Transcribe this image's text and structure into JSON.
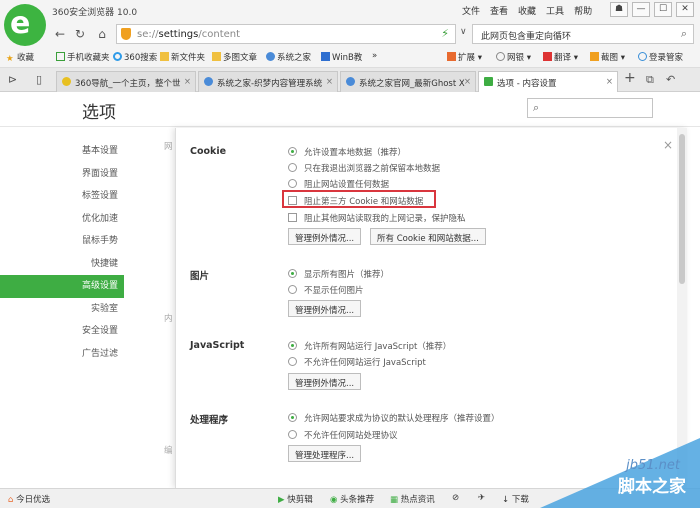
{
  "window": {
    "title": "360安全浏览器 10.0"
  },
  "menu": [
    "文件",
    "查看",
    "收藏",
    "工具",
    "帮助"
  ],
  "window_controls": {
    "settings": "☗",
    "minimize": "—",
    "maximize": "☐",
    "close": "✕"
  },
  "address": {
    "scheme": "se://",
    "bold": "settings",
    "path": "/content"
  },
  "search": {
    "value": "此网页包含重定向循环"
  },
  "bookmarks": {
    "items": [
      "收藏",
      "手机收藏夹",
      "360搜索",
      "新文件夹",
      "多图文章",
      "系统之家",
      "WinB教",
      "»"
    ],
    "right": [
      "扩展",
      "网银",
      "翻译",
      "截图",
      "登录管家"
    ]
  },
  "tabs": [
    {
      "label": "360导航_一个主页，整个世",
      "active": false
    },
    {
      "label": "系统之家-织梦内容管理系统",
      "active": false
    },
    {
      "label": "系统之家官网_最新Ghost X",
      "active": false
    },
    {
      "label": "选项 - 内容设置",
      "active": true
    }
  ],
  "settings": {
    "title": "选项",
    "sidebar": [
      "基本设置",
      "界面设置",
      "标签设置",
      "优化加速",
      "鼠标手势",
      "快捷键",
      "高级设置",
      "实验室",
      "安全设置",
      "广告过滤"
    ],
    "active_index": 6,
    "bg_hints": [
      "网",
      "内",
      "编"
    ]
  },
  "panel": {
    "close": "×",
    "sections": [
      {
        "title": "Cookie",
        "options": [
          {
            "kind": "radio",
            "checked": true,
            "label": "允许设置本地数据（推荐）"
          },
          {
            "kind": "radio",
            "checked": false,
            "label": "只在我退出浏览器之前保留本地数据"
          },
          {
            "kind": "radio",
            "checked": false,
            "label": "阻止网站设置任何数据"
          },
          {
            "kind": "checkbox",
            "checked": false,
            "label": "阻止第三方 Cookie 和网站数据"
          },
          {
            "kind": "checkbox",
            "checked": false,
            "label": "阻止其他网站读取我的上网记录，保护隐私"
          }
        ],
        "buttons": [
          "管理例外情况...",
          "所有 Cookie 和网站数据..."
        ]
      },
      {
        "title": "图片",
        "options": [
          {
            "kind": "radio",
            "checked": true,
            "label": "显示所有图片（推荐）"
          },
          {
            "kind": "radio",
            "checked": false,
            "label": "不显示任何图片"
          }
        ],
        "buttons": [
          "管理例外情况..."
        ]
      },
      {
        "title": "JavaScript",
        "options": [
          {
            "kind": "radio",
            "checked": true,
            "label": "允许所有网站运行 JavaScript（推荐）"
          },
          {
            "kind": "radio",
            "checked": false,
            "label": "不允许任何网站运行 JavaScript"
          }
        ],
        "buttons": [
          "管理例外情况..."
        ]
      },
      {
        "title": "处理程序",
        "options": [
          {
            "kind": "radio",
            "checked": true,
            "label": "允许网站要求成为协议的默认处理程序（推荐设置）"
          },
          {
            "kind": "radio",
            "checked": false,
            "label": "不允许任何网站处理协议"
          }
        ],
        "buttons": [
          "管理处理程序..."
        ]
      }
    ]
  },
  "status": {
    "left": "今日优选",
    "items": [
      "快剪辑",
      "头条推荐",
      "热点资讯",
      "下载"
    ]
  },
  "watermark": {
    "site": "jb51.net",
    "name": "脚本之家"
  },
  "colors": {
    "accent": "#3ead43",
    "highlight": "#d9363e"
  }
}
